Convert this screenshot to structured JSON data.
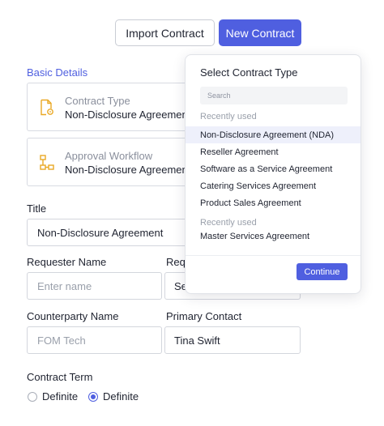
{
  "header": {
    "import_label": "Import Contract",
    "new_label": "New Contract"
  },
  "basic_details": {
    "title": "Basic Details",
    "contract_type": {
      "label": "Contract Type",
      "value": "Non-Disclosure Agreement"
    },
    "approval_workflow": {
      "label": "Approval Workflow",
      "value": "Non-Disclosure Agreement"
    }
  },
  "form": {
    "title_label": "Title",
    "title_value": "Non-Disclosure Agreement",
    "requester_name_label": "Requester Name",
    "requester_name_placeholder": "Enter name",
    "requester_email_label": "Req",
    "requester_email_value": "Se",
    "counterparty_label": "Counterparty Name",
    "counterparty_placeholder": "FOM Tech",
    "primary_contact_label": "Primary Contact",
    "primary_contact_value": "Tina Swift",
    "contract_term_label": "Contract Term",
    "term_options": [
      "Definite",
      "Definite"
    ],
    "term_selected_index": 1
  },
  "dropdown": {
    "title": "Select Contract Type",
    "search_placeholder": "Search",
    "group1_label": "Recently used",
    "group1_items": [
      "Non-Disclosure Agreement (NDA)",
      "Reseller Agreement",
      "Software as a Service Agreement",
      "Catering Services Agreement",
      "Product Sales Agreement"
    ],
    "group2_label": "Recently used",
    "group2_items": [
      "Master Services Agreement"
    ],
    "highlighted_item": "Non-Disclosure Agreement (NDA)",
    "continue_label": "Continue"
  },
  "colors": {
    "accent": "#4f5fe0",
    "icon_yellow": "#e9a825"
  }
}
